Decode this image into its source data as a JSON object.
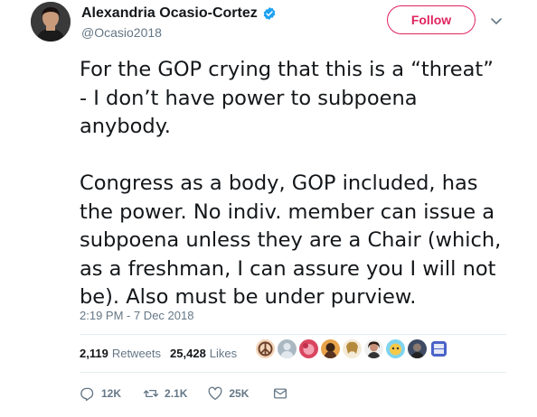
{
  "author": {
    "name": "Alexandria Ocasio-Cortez",
    "handle": "@Ocasio2018",
    "verified_color": "#1da1f2"
  },
  "follow_label": "Follow",
  "tweet": {
    "paragraphs": [
      "For the GOP crying that this is a “threat”\n- I don’t have power to subpoena\nanybody.",
      "Congress as a body, GOP included, has\nthe power. No indiv. member can issue a\nsubpoena unless they are a Chair (which,\nas a freshman, I can assure you I will not\nbe). Also must be under purview."
    ],
    "timestamp": "2:19 PM - 7 Dec 2018"
  },
  "stats": {
    "retweets_count": "2,119",
    "retweets_label": "Retweets",
    "likes_count": "25,428",
    "likes_label": "Likes"
  },
  "actions": {
    "reply_count": "12K",
    "retweet_count": "2.1K",
    "like_count": "25K"
  },
  "colors": {
    "accent": "#e0245e",
    "secondary_text": "#657786",
    "divider": "#e6ecf0"
  }
}
